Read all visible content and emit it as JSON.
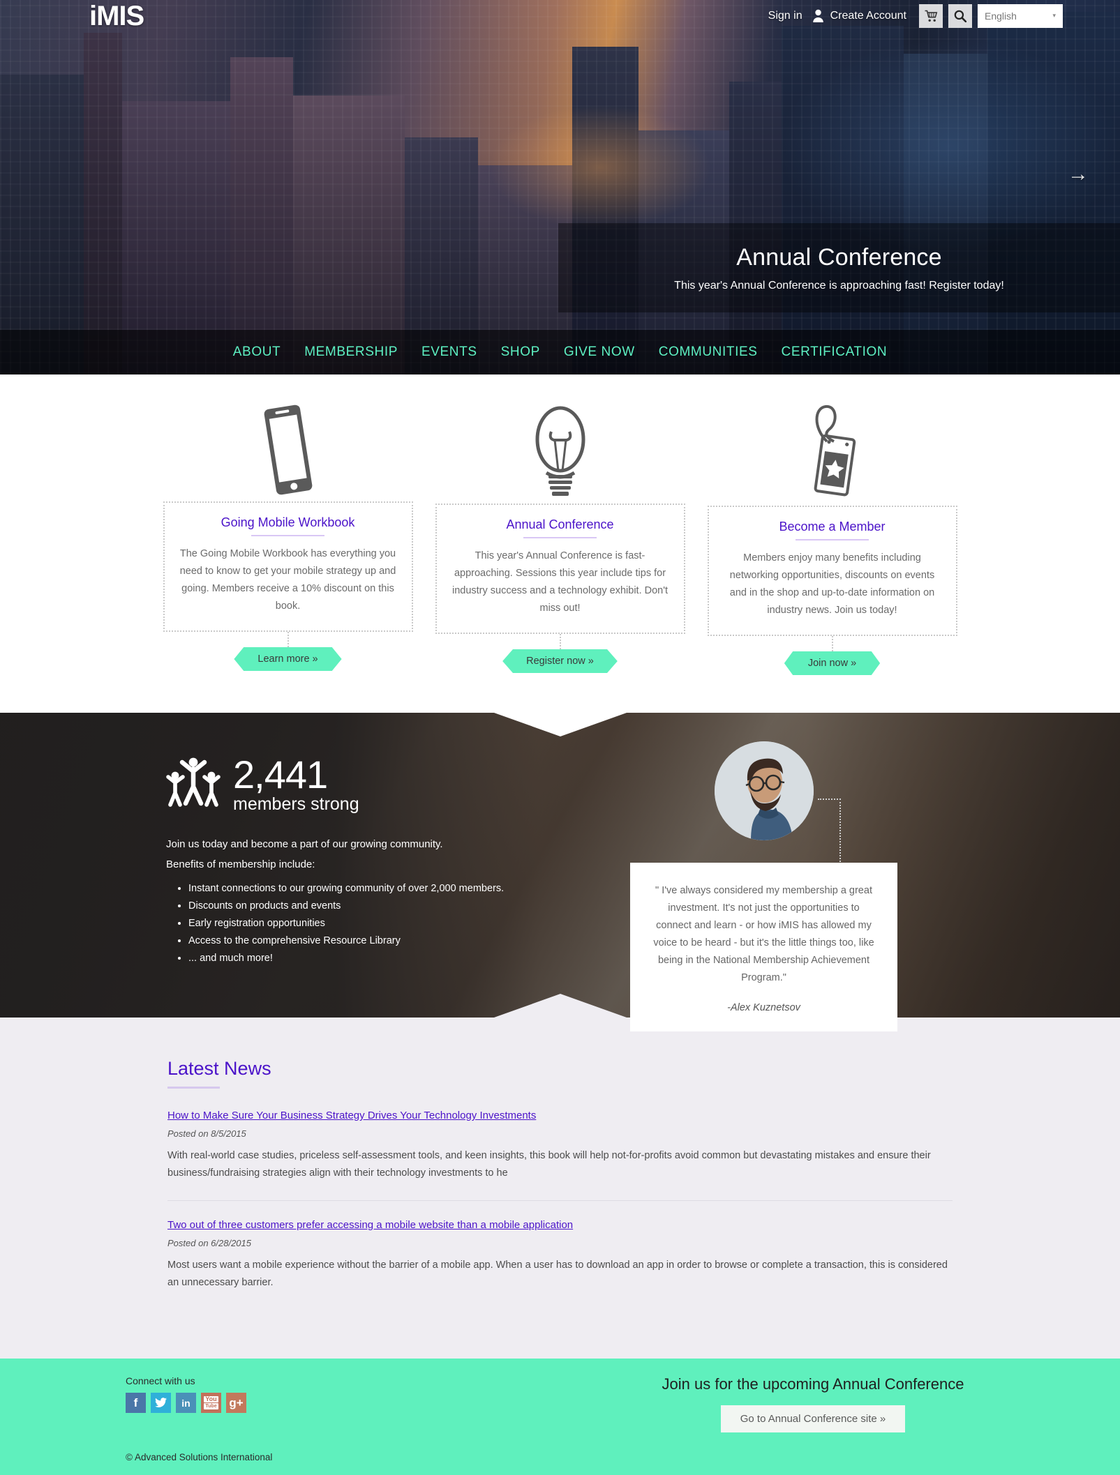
{
  "header": {
    "logo": "iMIS",
    "sign_in": "Sign in",
    "create_account": "Create Account",
    "cart_icon": "shopping-cart-icon",
    "search_icon": "search-icon",
    "language": "English",
    "language_caret": "▾"
  },
  "hero": {
    "title": "Annual Conference",
    "subtitle": "This year's Annual Conference is approaching fast! Register today!",
    "next_arrow": "→"
  },
  "nav": {
    "items": [
      {
        "label": "ABOUT"
      },
      {
        "label": "MEMBERSHIP"
      },
      {
        "label": "EVENTS"
      },
      {
        "label": "SHOP"
      },
      {
        "label": "GIVE NOW"
      },
      {
        "label": "COMMUNITIES"
      },
      {
        "label": "CERTIFICATION"
      }
    ]
  },
  "features": [
    {
      "icon": "mobile-phone-icon",
      "title": "Going Mobile Workbook",
      "body": "The Going Mobile Workbook has everything you need to know to get your mobile strategy up and going. Members receive a 10% discount on this book.",
      "button": "Learn more »"
    },
    {
      "icon": "lightbulb-icon",
      "title": "Annual Conference",
      "body": "This year's Annual Conference is fast-approaching. Sessions this year include tips for industry success and a technology exhibit. Don't miss out!",
      "button": "Register now »"
    },
    {
      "icon": "membership-badge-icon",
      "title": "Become a Member",
      "body": "Members enjoy many benefits including networking opportunities, discounts on events and in the shop and up-to-date information on industry news. Join us today!",
      "button": "Join now »"
    }
  ],
  "members": {
    "icon": "people-celebrating-icon",
    "count": "2,441",
    "count_label": "members strong",
    "intro_line1": "Join us today and become a part of our growing community.",
    "intro_line2": "Benefits of membership include:",
    "benefits": [
      "Instant connections to our growing community of over 2,000 members.",
      "Discounts on products and events",
      "Early registration opportunities",
      "Access to the comprehensive Resource Library",
      "... and much more!"
    ],
    "testimonial": {
      "quote": "\" I've always considered my membership a great investment. It's not just the opportunities to connect and learn - or how iMIS has allowed my voice to be heard - but it's the little things too, like being in the National Membership Achievement Program.\"",
      "author": "-Alex Kuznetsov"
    }
  },
  "news": {
    "title": "Latest News",
    "items": [
      {
        "headline": "How to Make Sure Your Business Strategy Drives Your Technology Investments",
        "date": "Posted on 8/5/2015",
        "excerpt": "With real-world case studies, priceless self-assessment tools, and keen insights, this book will help not-for-profits avoid common but devastating mistakes and ensure their business/fundraising strategies align with their technology investments to he"
      },
      {
        "headline": "Two out of three customers prefer accessing a mobile website than a mobile application",
        "date": "Posted on 6/28/2015",
        "excerpt": "Most users want a mobile experience without the barrier of a mobile app. When a user has to download an app in order to browse or complete a transaction, this is considered an unnecessary barrier."
      }
    ]
  },
  "footer": {
    "connect_label": "Connect with us",
    "social": [
      {
        "name": "facebook-icon",
        "glyph": "f"
      },
      {
        "name": "twitter-icon",
        "glyph": "🐦"
      },
      {
        "name": "linkedin-icon",
        "glyph": "in"
      },
      {
        "name": "youtube-icon",
        "glyph": "You"
      },
      {
        "name": "googleplus-icon",
        "glyph": "g+"
      }
    ],
    "cta_heading": "Join us for the upcoming Annual Conference",
    "cta_button": "Go to Annual Conference site »",
    "copyright": "© Advanced Solutions International"
  },
  "colors": {
    "accent_green": "#5ff0bd",
    "purple": "#4b13c9",
    "news_bg": "#efedf2",
    "dark": "#2b2a2a"
  }
}
